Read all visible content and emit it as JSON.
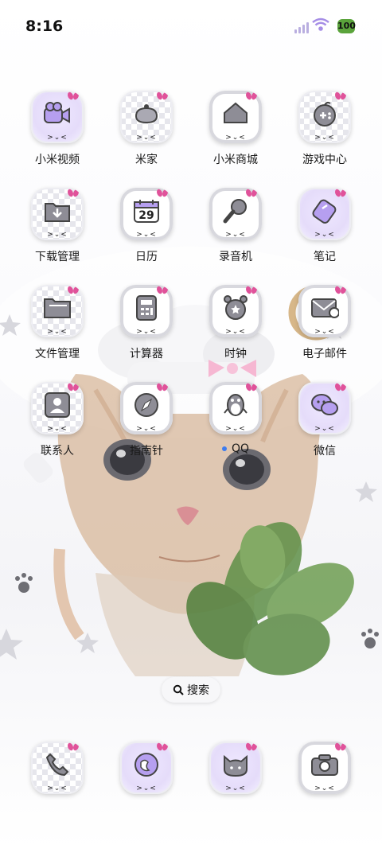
{
  "status_bar": {
    "time": "8:16",
    "battery": "100"
  },
  "apps": [
    {
      "label": "小米视频",
      "icon": "video-camera-icon"
    },
    {
      "label": "米家",
      "icon": "mijia-icon"
    },
    {
      "label": "小米商城",
      "icon": "mi-store-icon"
    },
    {
      "label": "游戏中心",
      "icon": "gamepad-icon"
    },
    {
      "label": "下载管理",
      "icon": "download-folder-icon"
    },
    {
      "label": "日历",
      "icon": "calendar-icon",
      "badge": "29"
    },
    {
      "label": "录音机",
      "icon": "microphone-icon"
    },
    {
      "label": "笔记",
      "icon": "note-tag-icon"
    },
    {
      "label": "文件管理",
      "icon": "folder-icon"
    },
    {
      "label": "计算器",
      "icon": "calculator-icon"
    },
    {
      "label": "时钟",
      "icon": "alarm-clock-icon"
    },
    {
      "label": "电子邮件",
      "icon": "mail-icon"
    },
    {
      "label": "联系人",
      "icon": "contact-icon"
    },
    {
      "label": "指南针",
      "icon": "compass-icon"
    },
    {
      "label": "QQ",
      "icon": "penguin-icon",
      "new_dot": true
    },
    {
      "label": "微信",
      "icon": "chat-bubbles-icon"
    }
  ],
  "search": {
    "label": "搜索"
  },
  "dock": [
    {
      "icon": "phone-icon"
    },
    {
      "icon": "browser-globe-icon"
    },
    {
      "icon": "cat-icon"
    },
    {
      "icon": "camera-icon"
    }
  ],
  "face_text": ">⌄<"
}
